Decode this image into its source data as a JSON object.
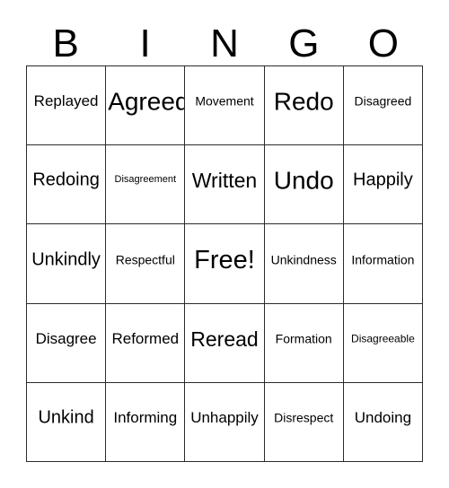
{
  "card": {
    "title_letters": [
      "B",
      "I",
      "N",
      "G",
      "O"
    ],
    "grid": {
      "rows": 5,
      "columns": 5,
      "border_color": "#2b2b2b",
      "background_color": "#ffffff",
      "text_color": "#000000"
    },
    "cells": [
      [
        {
          "text": "Replayed",
          "size": "fs-m"
        },
        {
          "text": "Agreed",
          "size": "fs-xxl"
        },
        {
          "text": "Movement",
          "size": "fs-s"
        },
        {
          "text": "Redo",
          "size": "fs-xxl"
        },
        {
          "text": "Disagreed",
          "size": "fs-s"
        }
      ],
      [
        {
          "text": "Redoing",
          "size": "fs-l"
        },
        {
          "text": "Disagreement",
          "size": "fs-xxs"
        },
        {
          "text": "Written",
          "size": "fs-xl"
        },
        {
          "text": "Undo",
          "size": "fs-xxl"
        },
        {
          "text": "Happily",
          "size": "fs-l"
        }
      ],
      [
        {
          "text": "Unkindly",
          "size": "fs-l"
        },
        {
          "text": "Respectful",
          "size": "fs-s"
        },
        {
          "text": "Free!",
          "size": "fs-free"
        },
        {
          "text": "Unkindness",
          "size": "fs-s"
        },
        {
          "text": "Information",
          "size": "fs-s"
        }
      ],
      [
        {
          "text": "Disagree",
          "size": "fs-m"
        },
        {
          "text": "Reformed",
          "size": "fs-m"
        },
        {
          "text": "Reread",
          "size": "fs-xl"
        },
        {
          "text": "Formation",
          "size": "fs-s"
        },
        {
          "text": "Disagreeable",
          "size": "fs-xs"
        }
      ],
      [
        {
          "text": "Unkind",
          "size": "fs-l"
        },
        {
          "text": "Informing",
          "size": "fs-m"
        },
        {
          "text": "Unhappily",
          "size": "fs-m"
        },
        {
          "text": "Disrespect",
          "size": "fs-s"
        },
        {
          "text": "Undoing",
          "size": "fs-m"
        }
      ]
    ]
  }
}
